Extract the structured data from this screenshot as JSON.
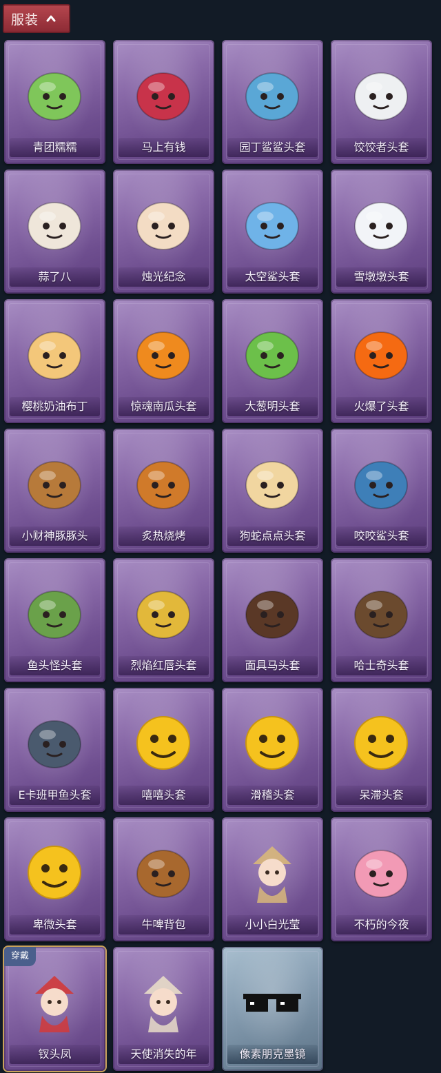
{
  "header": {
    "tab_label": "服装"
  },
  "equipped_badge": "穿戴",
  "items": [
    {
      "name": "青团糯糯",
      "icon": "green-dumpling-icon",
      "color": "#7fc65a"
    },
    {
      "name": "马上有钱",
      "icon": "red-horse-icon",
      "color": "#c8334a"
    },
    {
      "name": "园丁鲨鲨头套",
      "icon": "blue-shark-bee-icon",
      "color": "#5aa7d6"
    },
    {
      "name": "饺饺者头套",
      "icon": "dumpling-cloud-icon",
      "color": "#eef0f2"
    },
    {
      "name": "蒜了八",
      "icon": "garlic-icon",
      "color": "#efe6da"
    },
    {
      "name": "烛光纪念",
      "icon": "candle-icon",
      "color": "#f3dcc4"
    },
    {
      "name": "太空鲨头套",
      "icon": "space-shark-icon",
      "color": "#6fb3e8"
    },
    {
      "name": "雪墩墩头套",
      "icon": "snowman-icon",
      "color": "#f2f4f8"
    },
    {
      "name": "樱桃奶油布丁",
      "icon": "pudding-icon",
      "color": "#f3c77a"
    },
    {
      "name": "惊魂南瓜头套",
      "icon": "pumpkin-icon",
      "color": "#ef8a1e"
    },
    {
      "name": "大葱明头套",
      "icon": "scallion-icon",
      "color": "#6cc04a"
    },
    {
      "name": "火爆了头套",
      "icon": "fireball-icon",
      "color": "#f56a12"
    },
    {
      "name": "小财神豚豚头",
      "icon": "capybara-icon",
      "color": "#b77a3a"
    },
    {
      "name": "炙热烧烤",
      "icon": "grilled-meat-icon",
      "color": "#d07a2a"
    },
    {
      "name": "狗蛇点点头套",
      "icon": "snake-head-icon",
      "color": "#f1d6a0"
    },
    {
      "name": "咬咬鲨头套",
      "icon": "biting-shark-icon",
      "color": "#3e7fb8"
    },
    {
      "name": "鱼头怪头套",
      "icon": "fish-mask-icon",
      "color": "#6aa14a"
    },
    {
      "name": "烈焰红唇头套",
      "icon": "yellow-mask-sunglasses-icon",
      "color": "#e2b83a"
    },
    {
      "name": "面具马头套",
      "icon": "horse-mask-icon",
      "color": "#5a3826"
    },
    {
      "name": "哈士奇头套",
      "icon": "husky-icon",
      "color": "#6b4a2e"
    },
    {
      "name": "E卡班甲鱼头套",
      "icon": "whale-head-icon",
      "color": "#4a5a6e"
    },
    {
      "name": "嘻嘻头套",
      "icon": "grin-emoji-icon",
      "color": "#f5c21e"
    },
    {
      "name": "滑稽头套",
      "icon": "smirk-emoji-icon",
      "color": "#f5c21e"
    },
    {
      "name": "呆滞头套",
      "icon": "blank-stare-emoji-icon",
      "color": "#f5c21e"
    },
    {
      "name": "卑微头套",
      "icon": "humble-emoji-icon",
      "color": "#f5c21e"
    },
    {
      "name": "牛啤背包",
      "icon": "cow-beer-backpack-icon",
      "color": "#a8682e"
    },
    {
      "name": "小小白光莹",
      "icon": "chibi-warrior-icon",
      "color": "#d8b77a"
    },
    {
      "name": "不朽的今夜",
      "icon": "pink-cat-sundae-icon",
      "color": "#f29ab5"
    },
    {
      "name": "钗头凤",
      "icon": "phoenix-crown-girl-icon",
      "color": "#d23a3a",
      "equipped": true
    },
    {
      "name": "天使消失的年",
      "icon": "angel-girl-icon",
      "color": "#e8dcc8"
    },
    {
      "name": "像素朋克墨镜",
      "icon": "pixel-sunglasses-icon",
      "color": "#111111",
      "blue": true
    }
  ]
}
